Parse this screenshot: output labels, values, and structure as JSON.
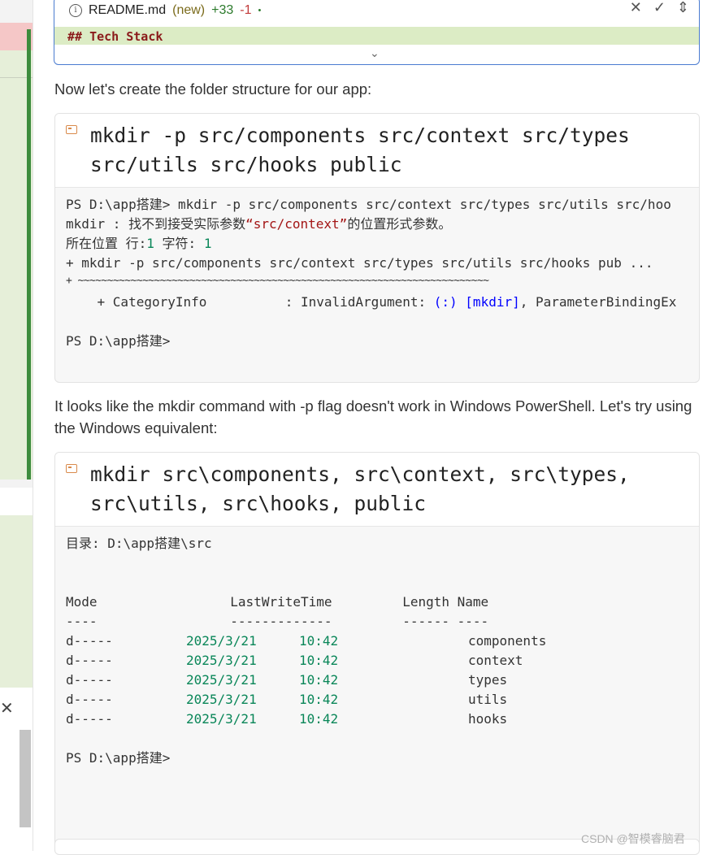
{
  "readme": {
    "filename": "README.md",
    "status": "(new)",
    "added": "+33",
    "removed": "-1",
    "dot": "•",
    "close": "✕",
    "accept": "✓",
    "more": "⇕",
    "code_line": "## Tech Stack",
    "expand": "⌄"
  },
  "para1": "Now let's create the folder structure for our app:",
  "cmd1": {
    "line1": "mkdir -p src/components src/context src/types",
    "line2": "src/utils src/hooks public",
    "out": {
      "l1": "PS D:\\app搭建> mkdir -p src/components src/context src/types src/utils src/hoo",
      "l2a": "mkdir : 找不到接受实际参数",
      "l2b": "“src/context”",
      "l2c": "的位置形式参数。",
      "l3a": "所在位置 行:",
      "l3b": "1",
      "l3c": " 字符: ",
      "l3d": "1",
      "l4": "+ mkdir -p src/components src/context src/types src/utils src/hooks pub ...",
      "l5": "+ ~~~~~~~~~~~~~~~~~~~~~~~~~~~~~~~~~~~~~~~~~~~~~~~~~~~~~~~~~~~~~~~~~~~~~~",
      "l6a": "    + CategoryInfo          : InvalidArgument: ",
      "l6b": "(:)",
      "l6c": " ",
      "l6d": "[mkdir]",
      "l6e": ", ParameterBindingEx",
      "l7": "PS D:\\app搭建>"
    }
  },
  "para2": "It looks like the mkdir command with -p flag doesn't work in Windows PowerShell. Let's try using the Windows equivalent:",
  "cmd2": {
    "line1": "mkdir src\\components, src\\context, src\\types,",
    "line2": "src\\utils, src\\hooks, public",
    "out": {
      "dir": "目录: D:\\app搭建\\src",
      "hdr": "Mode                 LastWriteTime         Length Name",
      "sep": "----                 -------------         ------ ----",
      "rows": [
        {
          "mode": "d-----",
          "date": "2025/3/21",
          "time": "10:42",
          "name": "components"
        },
        {
          "mode": "d-----",
          "date": "2025/3/21",
          "time": "10:42",
          "name": "context"
        },
        {
          "mode": "d-----",
          "date": "2025/3/21",
          "time": "10:42",
          "name": "types"
        },
        {
          "mode": "d-----",
          "date": "2025/3/21",
          "time": "10:42",
          "name": "utils"
        },
        {
          "mode": "d-----",
          "date": "2025/3/21",
          "time": "10:42",
          "name": "hooks"
        }
      ],
      "prompt": "PS D:\\app搭建>"
    }
  },
  "left": {
    "close": "✕"
  },
  "watermark": "CSDN @智模睿脑君"
}
